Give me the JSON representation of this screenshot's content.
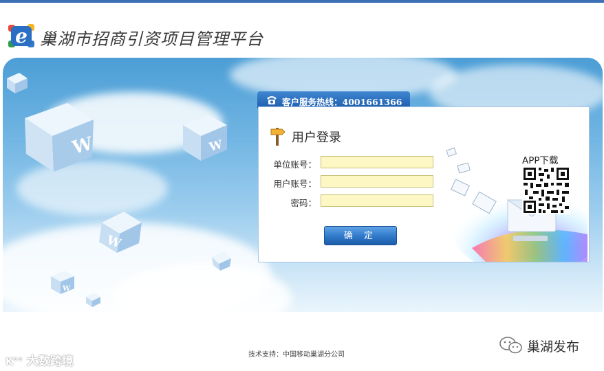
{
  "header": {
    "title": "巢湖市招商引资项目管理平台",
    "logo_letter": "e"
  },
  "hotline": {
    "text": "客户服务热线：4001661366"
  },
  "login": {
    "title": "用户登录",
    "fields": [
      {
        "label": "单位账号：",
        "value": "",
        "placeholder": ""
      },
      {
        "label": "用户账号：",
        "value": "",
        "placeholder": ""
      },
      {
        "label": "密码：",
        "value": "",
        "placeholder": ""
      }
    ],
    "submit_label": "确 定"
  },
  "app_download": {
    "label": "APP下载"
  },
  "footer": {
    "support_text": "技术支持：中国移动巢湖分公司"
  },
  "watermarks": {
    "left": "大数跨境",
    "left_mark": "K°°",
    "right": "巢湖发布"
  },
  "colors": {
    "accent_blue": "#2f78c9",
    "input_bg": "#fdf7c3",
    "top_line": "#3b6fb6"
  }
}
